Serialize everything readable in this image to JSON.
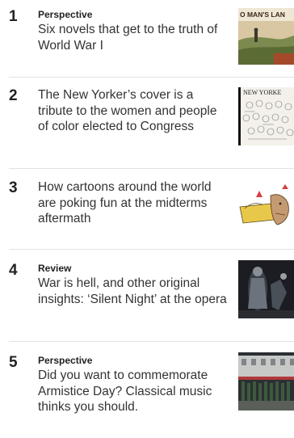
{
  "stories": [
    {
      "number": "1",
      "kicker": "Perspective",
      "headline": "Six novels that get to the truth of World War I",
      "thumb_caption": "O MAN'S LAN"
    },
    {
      "number": "2",
      "kicker": "",
      "headline": "The New Yorker’s cover is a tribute to the women and people of color elected to Congress",
      "thumb_caption": "NEW YORKE"
    },
    {
      "number": "3",
      "kicker": "",
      "headline": "How cartoons around the world are poking fun at the midterms aftermath"
    },
    {
      "number": "4",
      "kicker": "Review",
      "headline": "War is hell, and other original insights: ‘Silent Night’ at the opera"
    },
    {
      "number": "5",
      "kicker": "Perspective",
      "headline": "Did you want to commemorate Armistice Day? Classical music thinks you should."
    }
  ]
}
